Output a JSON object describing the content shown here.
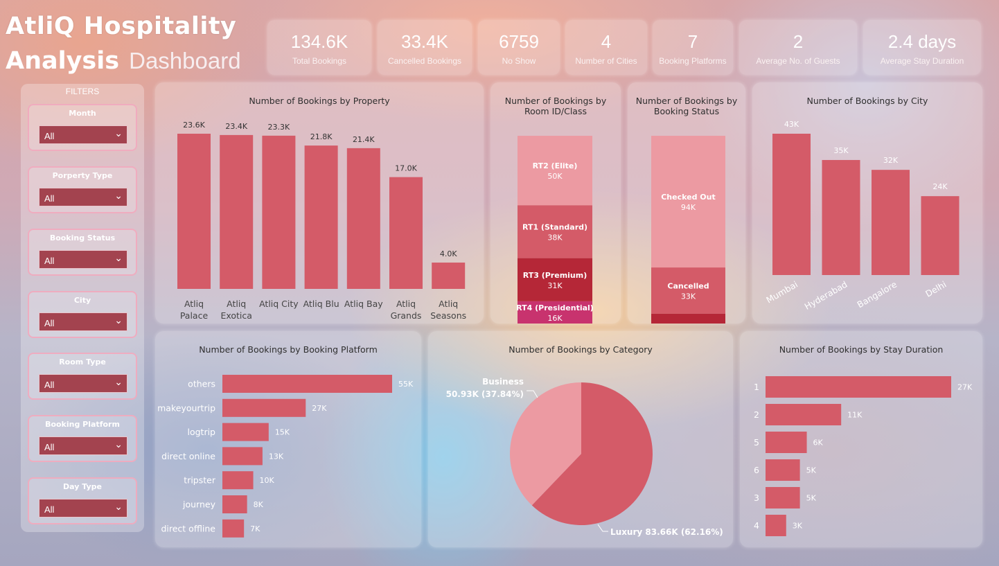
{
  "header": {
    "title_line1": "AtliQ Hospitality",
    "title_line2_bold": "Analysis",
    "title_line2_light": "Dashboard"
  },
  "kpis": [
    {
      "value": "134.6K",
      "label": "Total Bookings"
    },
    {
      "value": "33.4K",
      "label": "Cancelled Bookings"
    },
    {
      "value": "6759",
      "label": "No Show"
    },
    {
      "value": "4",
      "label": "Number of Cities"
    },
    {
      "value": "7",
      "label": "Booking Platforms"
    },
    {
      "value": "2",
      "label": "Average No. of Guests"
    },
    {
      "value": "2.4 days",
      "label": "Average Stay Duration"
    }
  ],
  "filters": {
    "header": "FILTERS",
    "items": [
      {
        "label": "Month",
        "value": "All"
      },
      {
        "label": "Porperty Type",
        "value": "All"
      },
      {
        "label": "Booking Status",
        "value": "All"
      },
      {
        "label": "City",
        "value": "All"
      },
      {
        "label": "Room Type",
        "value": "All"
      },
      {
        "label": "Booking Platform",
        "value": "All"
      },
      {
        "label": "Day Type",
        "value": "All"
      }
    ],
    "chevron_icon": "chevron-down-icon"
  },
  "colors": {
    "bar": "#d45b68",
    "light": "#ec9aa2",
    "dark": "#b52737",
    "magenta": "#c8336e"
  },
  "chart_data": [
    {
      "type": "bar",
      "title": "Number of Bookings by Property",
      "categories": [
        "Atliq Palace",
        "Atliq Exotica",
        "Atliq City",
        "Atliq Blu",
        "Atliq Bay",
        "Atliq Grands",
        "Atliq Seasons"
      ],
      "values": [
        23600,
        23400,
        23300,
        21800,
        21400,
        17000,
        4000
      ],
      "labels": [
        "23.6K",
        "23.4K",
        "23.3K",
        "21.8K",
        "21.4K",
        "17.0K",
        "4.0K"
      ]
    },
    {
      "type": "bar",
      "stacked": true,
      "title": "Number of Bookings by Room ID/Class",
      "segments": [
        {
          "name": "RT2 (Elite)",
          "value": 50000,
          "label": "50K",
          "color": "#ec9aa2"
        },
        {
          "name": "RT1 (Standard)",
          "value": 38000,
          "label": "38K",
          "color": "#d45b68"
        },
        {
          "name": "RT3 (Premium)",
          "value": 31000,
          "label": "31K",
          "color": "#b52737"
        },
        {
          "name": "RT4 (Presidential)",
          "value": 16000,
          "label": "16K",
          "color": "#c8336e"
        }
      ]
    },
    {
      "type": "bar",
      "stacked": true,
      "title": "Number of Bookings by Booking Status",
      "segments": [
        {
          "name": "Checked Out",
          "value": 94000,
          "label": "94K",
          "color": "#ec9aa2"
        },
        {
          "name": "Cancelled",
          "value": 33000,
          "label": "33K",
          "color": "#d45b68"
        },
        {
          "name": "",
          "value": 7000,
          "label": "",
          "color": "#b52737"
        }
      ]
    },
    {
      "type": "bar",
      "title": "Number of Bookings by City",
      "categories": [
        "Mumbai",
        "Hyderabad",
        "Bangalore",
        "Delhi"
      ],
      "values": [
        43000,
        35000,
        32000,
        24000
      ],
      "labels": [
        "43K",
        "35K",
        "32K",
        "24K"
      ]
    },
    {
      "type": "bar",
      "orientation": "horizontal",
      "title": "Number of Bookings by Booking Platform",
      "categories": [
        "others",
        "makeyourtrip",
        "logtrip",
        "direct online",
        "tripster",
        "journey",
        "direct offline"
      ],
      "values": [
        55000,
        27000,
        15000,
        13000,
        10000,
        8000,
        7000
      ],
      "labels": [
        "55K",
        "27K",
        "15K",
        "13K",
        "10K",
        "8K",
        "7K"
      ]
    },
    {
      "type": "pie",
      "title": "Number of Bookings by Category",
      "slices": [
        {
          "name": "Business",
          "value": 50930,
          "label": "50.93K (37.84%)",
          "color": "#ec9aa2"
        },
        {
          "name": "Luxury",
          "value": 83660,
          "label": "83.66K (62.16%)",
          "color": "#d45b68"
        }
      ]
    },
    {
      "type": "bar",
      "orientation": "horizontal",
      "title": "Number of Bookings by Stay Duration",
      "categories": [
        "1",
        "2",
        "5",
        "6",
        "3",
        "4"
      ],
      "values": [
        27000,
        11000,
        6000,
        5000,
        5000,
        3000
      ],
      "labels": [
        "27K",
        "11K",
        "6K",
        "5K",
        "5K",
        "3K"
      ]
    }
  ]
}
